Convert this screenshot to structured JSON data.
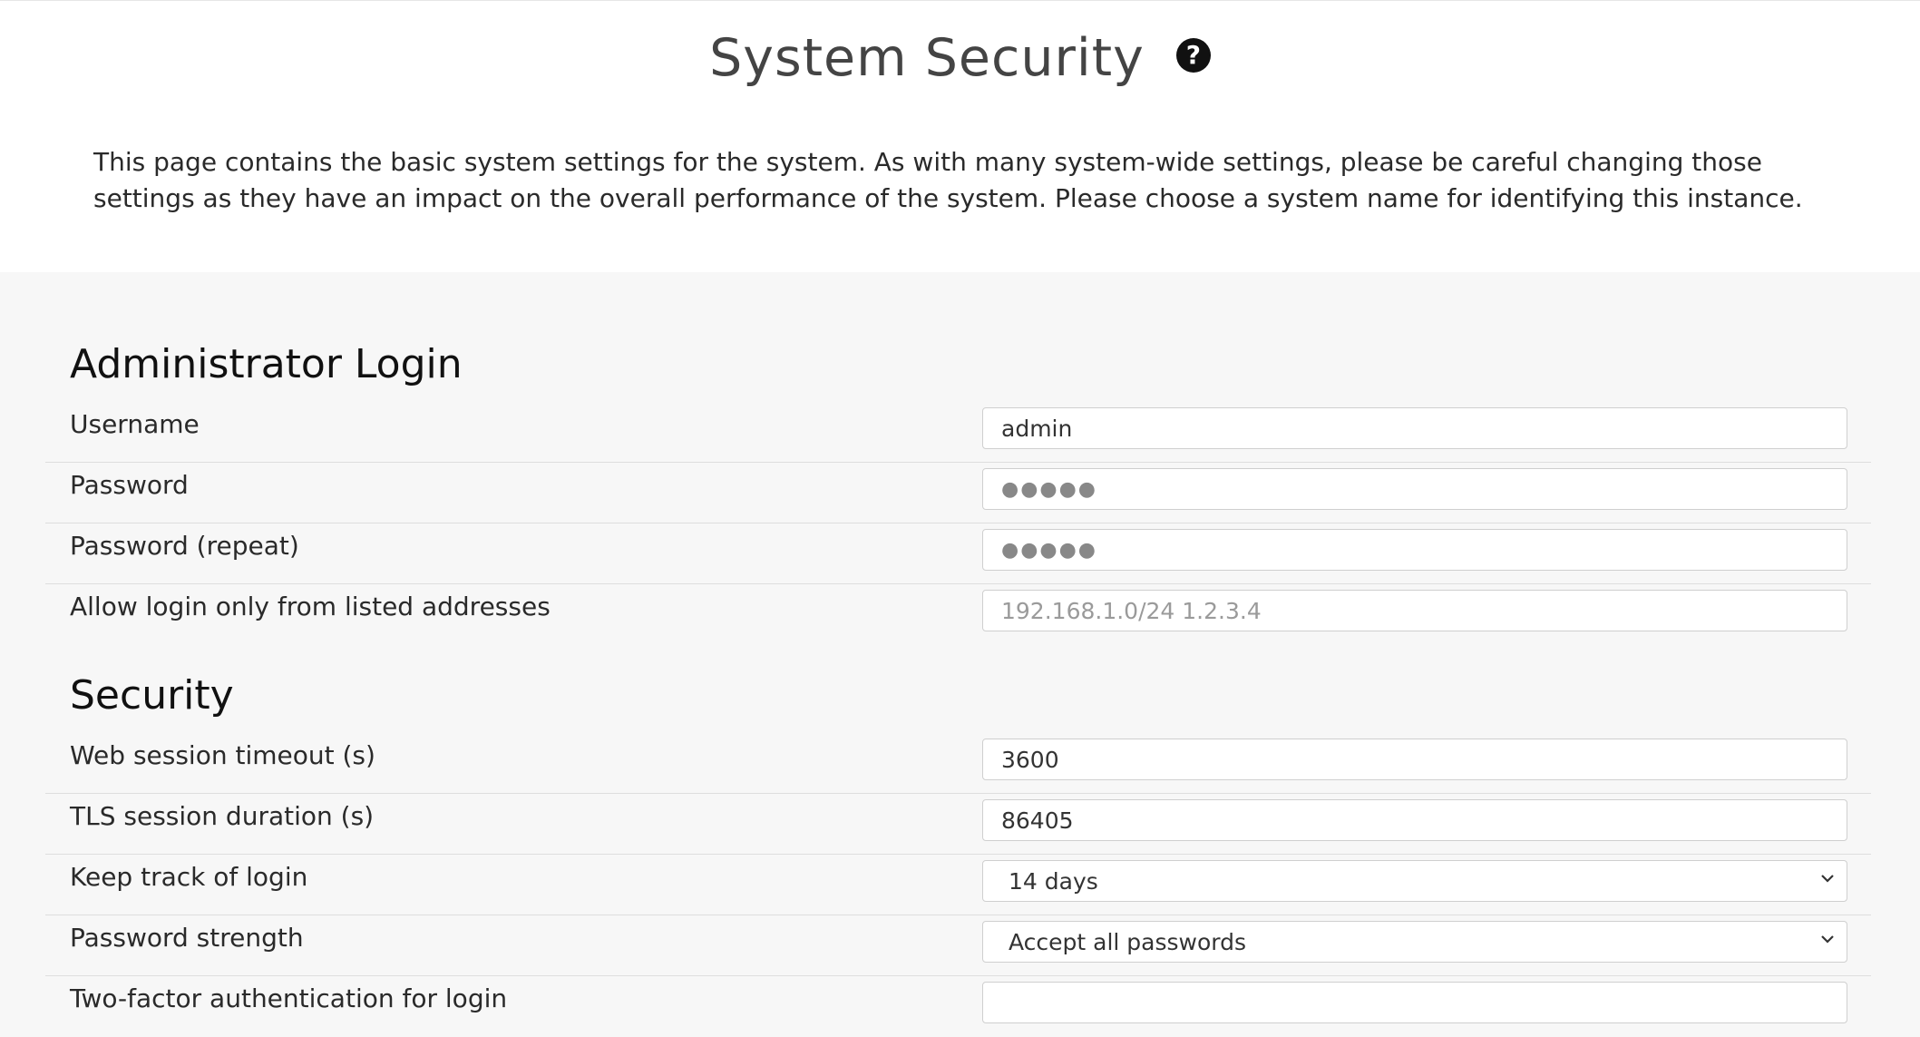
{
  "header": {
    "title": "System Security",
    "help_icon": "question-circle-icon",
    "intro": "This page contains the basic system settings for the system. As with many system-wide settings, please be careful changing those settings as they have an impact on the overall performance of the system. Please choose a system name for identifying this instance."
  },
  "admin": {
    "section_title": "Administrator Login",
    "username": {
      "label": "Username",
      "value": "admin"
    },
    "password": {
      "label": "Password",
      "value": "●●●●●"
    },
    "password_repeat": {
      "label": "Password (repeat)",
      "value": "●●●●●"
    },
    "allow_login": {
      "label": "Allow login only from listed addresses",
      "value": "",
      "placeholder": "192.168.1.0/24 1.2.3.4"
    }
  },
  "security": {
    "section_title": "Security",
    "web_session_timeout": {
      "label": "Web session timeout (s)",
      "value": "3600"
    },
    "tls_session_duration": {
      "label": "TLS session duration (s)",
      "value": "86405"
    },
    "keep_track": {
      "label": "Keep track of login",
      "value": "14 days"
    },
    "password_strength": {
      "label": "Password strength",
      "value": "Accept all passwords"
    },
    "two_factor": {
      "label": "Two-factor authentication for login"
    }
  },
  "icons": {
    "select_chevron": "chevron-down-icon"
  }
}
